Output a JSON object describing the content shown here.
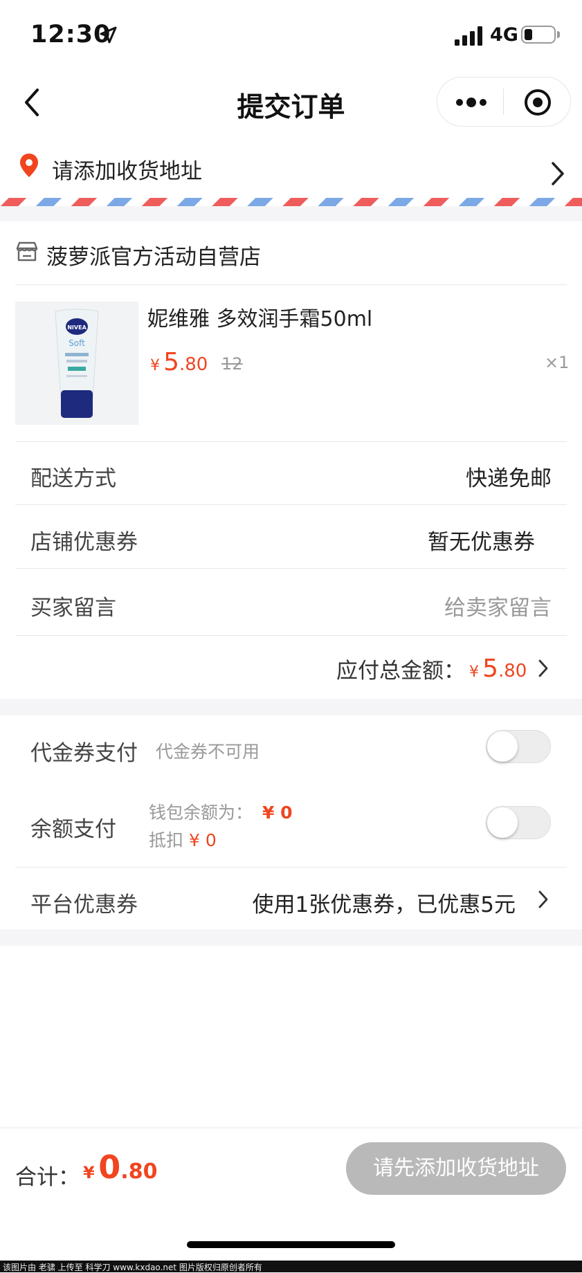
{
  "status_bar": {
    "time": "12:30",
    "network": "4G"
  },
  "nav": {
    "title": "提交订单"
  },
  "address": {
    "prompt": "请添加收货地址"
  },
  "store": {
    "name": "菠萝派官方活动自营店"
  },
  "product": {
    "name": "妮维雅 多效润手霜50ml",
    "price_symbol": "¥",
    "price_int": "5",
    "price_dec": ".80",
    "original_price": "12",
    "quantity": "×1",
    "image": {
      "brand": "NIVEA",
      "label": "Soft"
    }
  },
  "delivery": {
    "label": "配送方式",
    "value": "快递免邮"
  },
  "store_coupon": {
    "label": "店铺优惠券",
    "value": "暂无优惠券"
  },
  "buyer_message": {
    "label": "买家留言",
    "placeholder": "给卖家留言"
  },
  "total": {
    "label": "应付总金额：",
    "symbol": "¥",
    "int": "5",
    "dec": ".80"
  },
  "voucher_pay": {
    "label": "代金券支付",
    "status": "代金券不可用",
    "enabled": false
  },
  "balance_pay": {
    "label": "余额支付",
    "wallet_label": "钱包余额为：",
    "wallet_amount": "¥ 0",
    "deduct_label": "抵扣",
    "deduct_amount": "¥ 0",
    "enabled": false
  },
  "platform_coupon": {
    "label": "平台优惠券",
    "value": "使用1张优惠券，已优惠5元"
  },
  "bottom": {
    "sum_label": "合计：",
    "symbol": "¥",
    "int": "0",
    "dec": ".80",
    "submit_label": "请先添加收货地址"
  },
  "watermark": "该图片由 老骕 上传至 科学刀 www.kxdao.net 图片版权归原创者所有",
  "colors": {
    "accent": "#f0451f",
    "disabled_button": "#b9b9b9",
    "airmail_red": "#ee5d5c",
    "airmail_blue": "#7ca9e6"
  }
}
